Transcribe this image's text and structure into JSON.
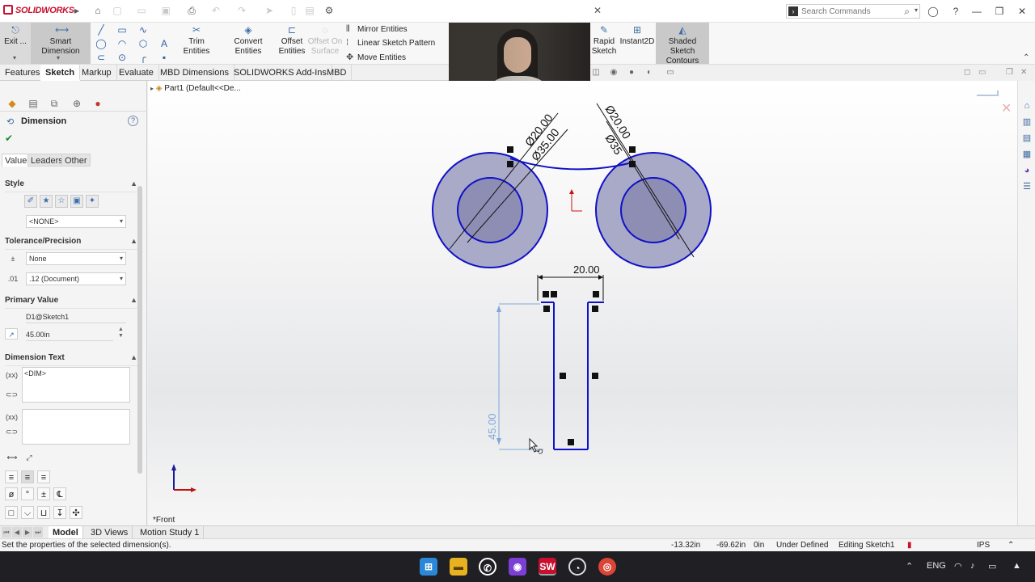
{
  "app": {
    "logo_text": "SOLIDWORKS",
    "search_placeholder": "Search Commands"
  },
  "ribbon": {
    "exit_label": "Exit ...",
    "smart_dimension": "Smart Dimension",
    "trim": "Trim Entities",
    "convert": "Convert Entities",
    "offset_1": "Offset",
    "offset_2": "Entities",
    "offset_surface_1": "Offset On",
    "offset_surface_2": "Surface",
    "mirror": "Mirror Entities",
    "linear_pattern": "Linear Sketch Pattern",
    "move": "Move Entities",
    "rapid_1": "Rapid",
    "rapid_2": "Sketch",
    "instant2d": "Instant2D",
    "shaded_1": "Shaded Sketch",
    "shaded_2": "Contours"
  },
  "tabs": [
    "Features",
    "Sketch",
    "Markup",
    "Evaluate",
    "MBD Dimensions",
    "SOLIDWORKS Add-Ins",
    "MBD"
  ],
  "active_tab": "Sketch",
  "panel": {
    "title": "Dimension",
    "help": "?",
    "ok": "✔",
    "subtabs": [
      "Value",
      "Leaders",
      "Other"
    ],
    "style": {
      "header": "Style",
      "favorite": "<NONE>"
    },
    "tolerance": {
      "header": "Tolerance/Precision",
      "tolerance_type": "None",
      "precision": ".12 (Document)"
    },
    "primary": {
      "header": "Primary Value",
      "name": "D1@Sketch1",
      "value": "45.00in"
    },
    "dim_text": {
      "header": "Dimension Text",
      "text": "<DIM>"
    }
  },
  "tree": {
    "part": "Part1  (Default<<De..."
  },
  "viewport": {
    "view_name": "*Front",
    "dim_top_width": "20.00",
    "dim_height": "45.00",
    "dim_d20_left": "Ø20.00",
    "dim_d35_left": "Ø35.00",
    "dim_d20_right": "Ø20.00",
    "dim_d35_right": "Ø35"
  },
  "bottom_tabs": [
    "Model",
    "3D Views",
    "Motion Study 1"
  ],
  "status": {
    "message": "Set the properties of the selected dimension(s).",
    "x": "-13.32in",
    "y": "-69.62in",
    "z": "0in",
    "state": "Under Defined",
    "editing": "Editing Sketch1",
    "units": "IPS"
  },
  "taskbar": {
    "lang": "ENG"
  },
  "colors": {
    "sketch_line": "#1010c8",
    "circle_fill": "#a9a9c8",
    "dim_selected": "#7fa8d8",
    "accent_red": "#c8102e",
    "taskbar": "#1f1f24"
  }
}
